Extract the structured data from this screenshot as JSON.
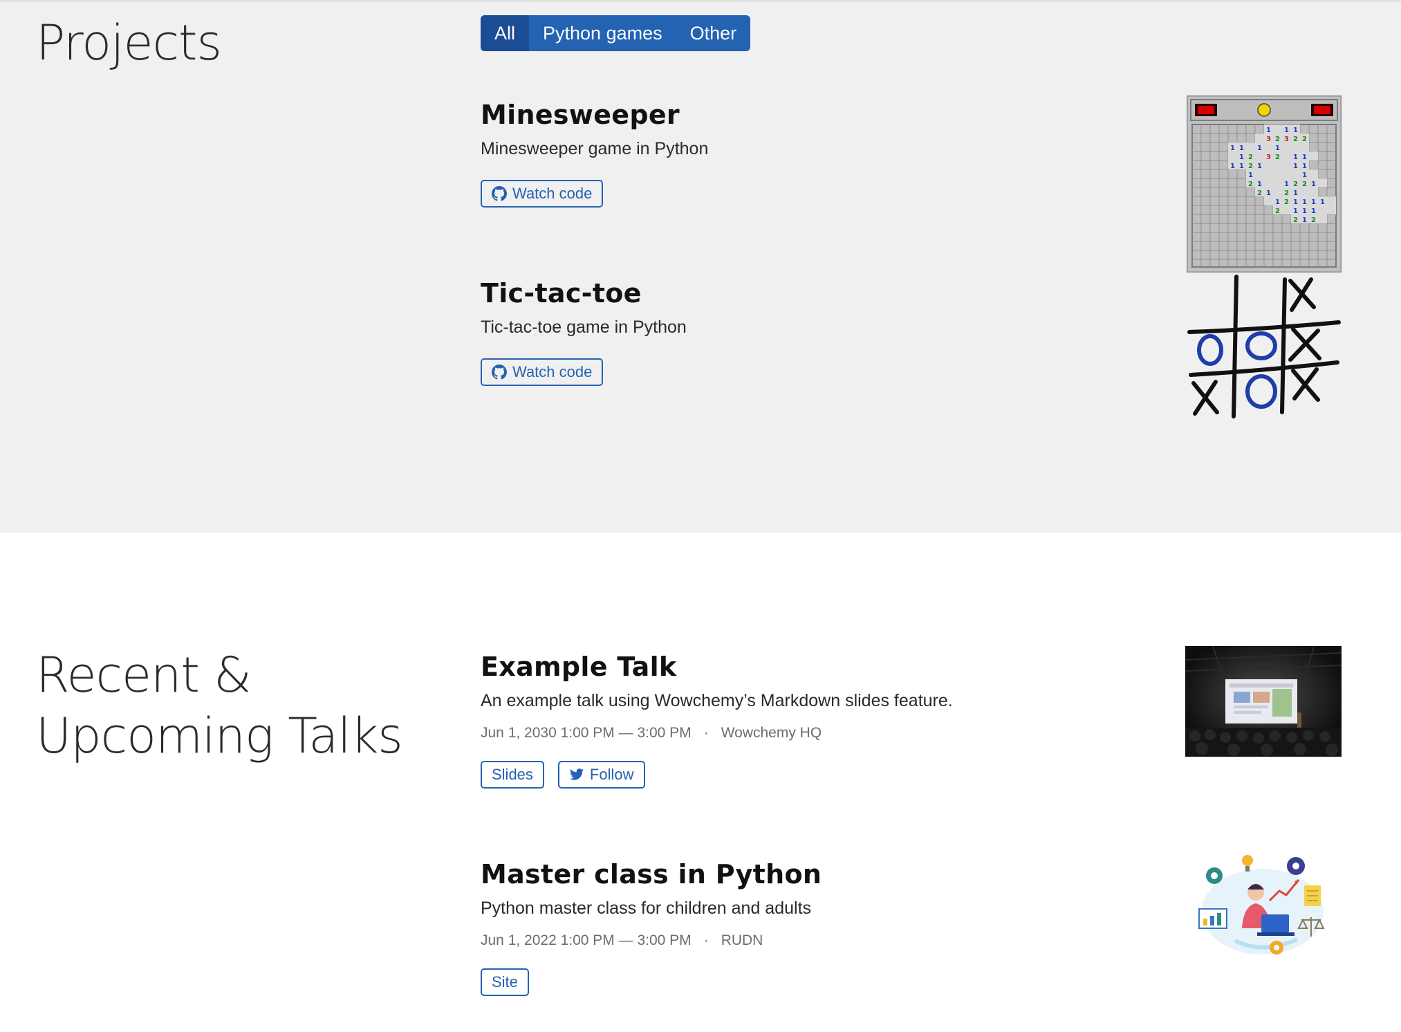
{
  "projects": {
    "title": "Projects",
    "filters": [
      {
        "label": "All",
        "active": true
      },
      {
        "label": "Python games",
        "active": false
      },
      {
        "label": "Other",
        "active": false
      }
    ],
    "items": [
      {
        "title": "Minesweeper",
        "summary": "Minesweeper game in Python",
        "button": {
          "label": "Watch code",
          "icon": "github-icon"
        },
        "thumbnail": "minesweeper-thumbnail"
      },
      {
        "title": "Tic-tac-toe",
        "summary": "Tic-tac-toe game in Python",
        "button": {
          "label": "Watch code",
          "icon": "github-icon"
        },
        "thumbnail": "tic-tac-toe-thumbnail"
      }
    ]
  },
  "talks": {
    "title_line1": "Recent &",
    "title_line2": "Upcoming Talks",
    "items": [
      {
        "title": "Example Talk",
        "summary": "An example talk using Wowchemy’s Markdown slides feature.",
        "date": "Jun 1, 2030 1:00 PM — 3:00 PM",
        "separator": "·",
        "location": "Wowchemy HQ",
        "buttons": [
          {
            "label": "Slides"
          },
          {
            "label": "Follow",
            "icon": "twitter-icon"
          }
        ],
        "thumbnail": "conference-photo"
      },
      {
        "title": "Master class in Python",
        "summary": "Python master class for children and adults",
        "date": "Jun 1, 2022 1:00 PM — 3:00 PM",
        "separator": "·",
        "location": "RUDN",
        "buttons": [
          {
            "label": "Site"
          }
        ],
        "thumbnail": "analytics-illustration"
      }
    ]
  },
  "colors": {
    "accent": "#2462b2",
    "accent_dark": "#1b4d94",
    "projects_bg": "#f0f0f0",
    "talks_bg": "#ffffff"
  }
}
